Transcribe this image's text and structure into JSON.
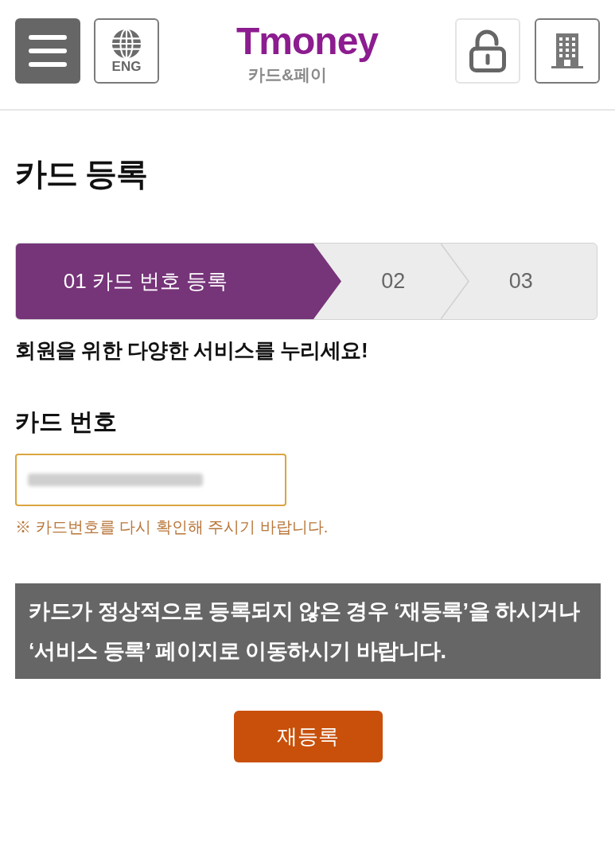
{
  "header": {
    "left_buttons": [
      {
        "kind": "menu"
      },
      {
        "kind": "language",
        "label": "ENG"
      }
    ],
    "logo": {
      "wordmark": "Tmoney",
      "subtitle": "카드&페이"
    },
    "right_buttons": [
      {
        "kind": "lock"
      },
      {
        "kind": "building"
      }
    ]
  },
  "page_title": "카드 등록",
  "steps": [
    {
      "label": "01 카드 번호 등록",
      "selected": true
    },
    {
      "label": "02",
      "selected": false
    },
    {
      "label": "03",
      "selected": false
    }
  ],
  "tagline": "회원을 위한 다양한 서비스를 누리세요!",
  "card_number": {
    "label": "카드 번호",
    "redacted": true,
    "focused": true,
    "hint": "※ 카드번호를 다시 확인해 주시기 바랍니다."
  },
  "notice": {
    "lines": [
      "카드가 정상적으로 등록되지 않은 경우 ‘재등록’을 하시거나",
      "‘서비스 등록’ 페이지로 이동하시기 바랍니다."
    ]
  },
  "retry_button": {
    "label": "재등록"
  }
}
